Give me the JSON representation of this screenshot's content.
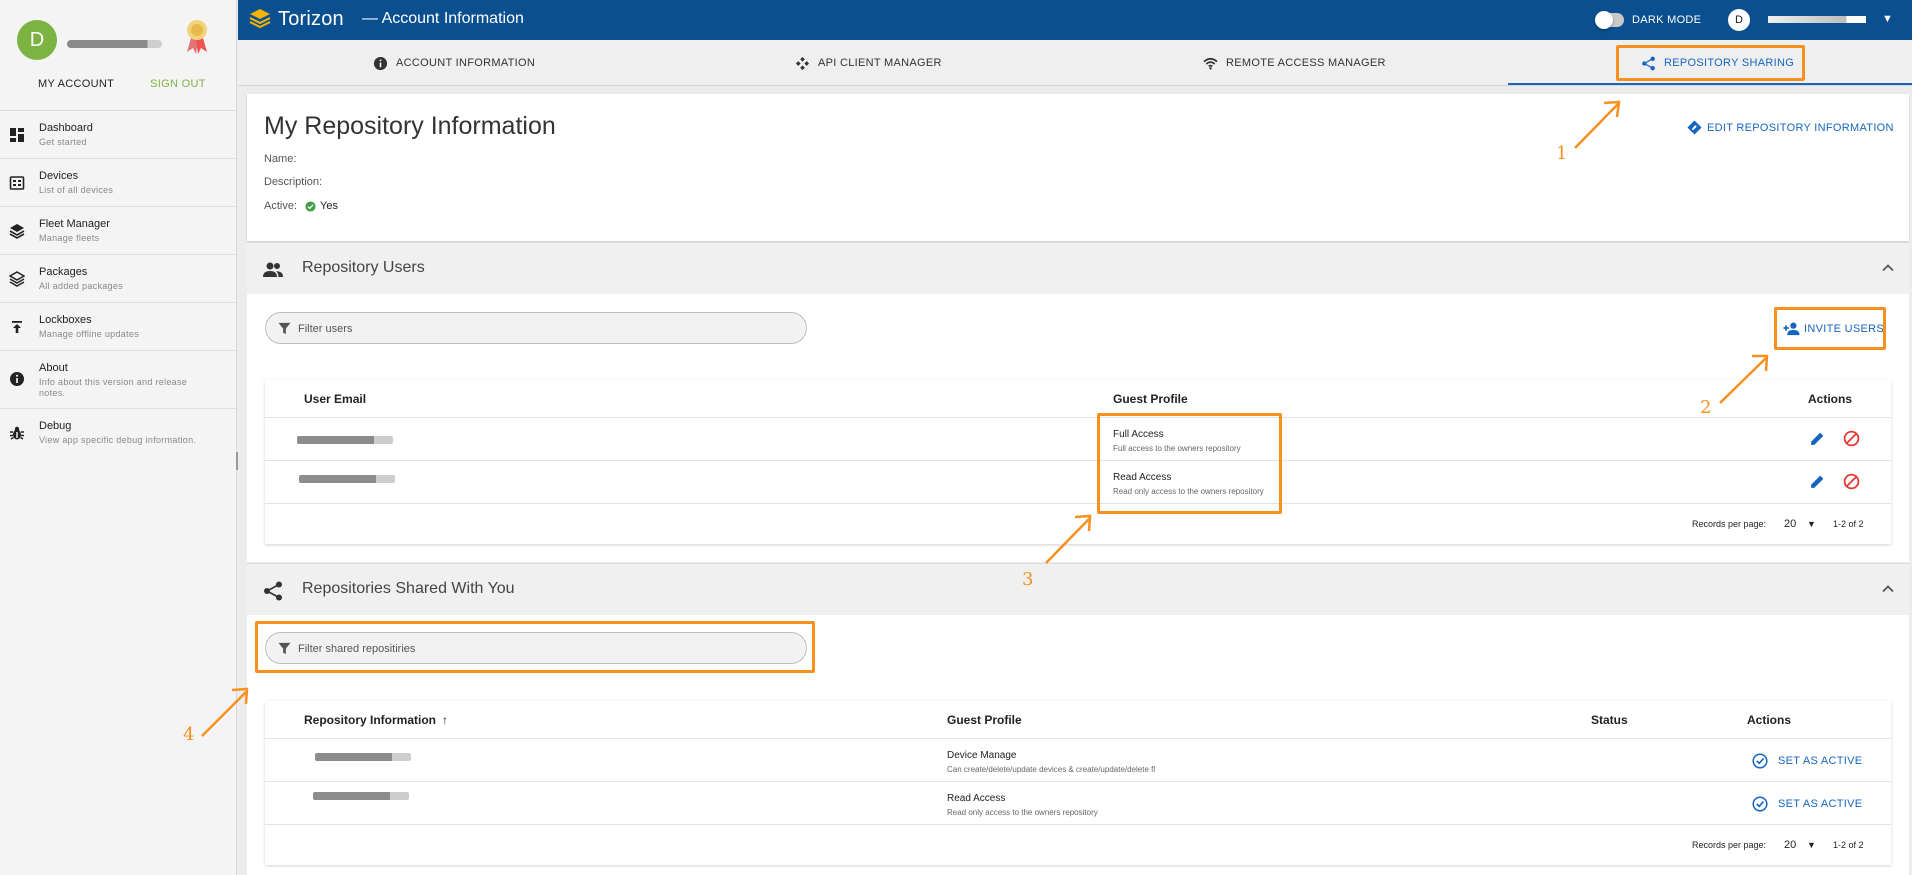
{
  "window": {
    "brand": "Torizon",
    "title": "— Account Information"
  },
  "profile": {
    "avatar_letter": "D",
    "my_account_label": "MY ACCOUNT",
    "sign_out_label": "SIGN OUT"
  },
  "sidebar": {
    "items": [
      {
        "title": "Dashboard",
        "subtitle": "Get started",
        "icon": "dashboard-icon"
      },
      {
        "title": "Devices",
        "subtitle": "List of all devices",
        "icon": "devices-icon"
      },
      {
        "title": "Fleet Manager",
        "subtitle": "Manage fleets",
        "icon": "layers-icon"
      },
      {
        "title": "Packages",
        "subtitle": "All added packages",
        "icon": "packages-icon"
      },
      {
        "title": "Lockboxes",
        "subtitle": "Manage offline updates",
        "icon": "upload-icon"
      },
      {
        "title": "About",
        "subtitle": "Info about this version and release notes.",
        "icon": "info-icon"
      },
      {
        "title": "Debug",
        "subtitle": "View app specific debug information.",
        "icon": "bug-icon"
      }
    ]
  },
  "topbar": {
    "dark_mode_label": "DARK MODE",
    "user_avatar_letter": "D"
  },
  "tabs": [
    {
      "label": "ACCOUNT INFORMATION",
      "icon": "info-icon"
    },
    {
      "label": "API CLIENT MANAGER",
      "icon": "api-icon"
    },
    {
      "label": "REMOTE ACCESS MANAGER",
      "icon": "wifi-icon"
    },
    {
      "label": "REPOSITORY SHARING",
      "icon": "share-icon",
      "active": true
    }
  ],
  "repo_info": {
    "heading": "My Repository Information",
    "name_label": "Name:",
    "description_label": "Description:",
    "active_label": "Active:",
    "active_value": "Yes",
    "edit_label": "EDIT REPOSITORY INFORMATION"
  },
  "repo_users": {
    "title": "Repository Users",
    "filter_placeholder": "Filter users",
    "invite_label": "INVITE USERS",
    "headers": {
      "email": "User Email",
      "profile": "Guest Profile",
      "actions": "Actions"
    },
    "rows": [
      {
        "profile_title": "Full Access",
        "profile_desc": "Full access to the owners repository"
      },
      {
        "profile_title": "Read Access",
        "profile_desc": "Read only access to the owners repository"
      }
    ],
    "footer": {
      "rpp_label": "Records per page:",
      "rpp_value": "20",
      "range": "1-2 of 2"
    }
  },
  "shared_repos": {
    "title": "Repositories Shared With You",
    "filter_placeholder": "Filter shared repositiries",
    "headers": {
      "info": "Repository Information",
      "profile": "Guest Profile",
      "status": "Status",
      "actions": "Actions"
    },
    "rows": [
      {
        "profile_title": "Device Manage",
        "profile_desc": "Can create/delete/update devices & create/update/delete fl",
        "action_label": "SET AS ACTIVE"
      },
      {
        "profile_title": "Read Access",
        "profile_desc": "Read only access to the owners repository",
        "action_label": "SET AS ACTIVE"
      }
    ],
    "footer": {
      "rpp_label": "Records per page:",
      "rpp_value": "20",
      "range": "1-2 of 2"
    }
  },
  "annotations": [
    "1",
    "2",
    "3",
    "4"
  ],
  "colors": {
    "brand_blue": "#0a4f8f",
    "accent": "#1565c0",
    "annotation": "#f7901e",
    "sign_out": "#7cb342"
  }
}
